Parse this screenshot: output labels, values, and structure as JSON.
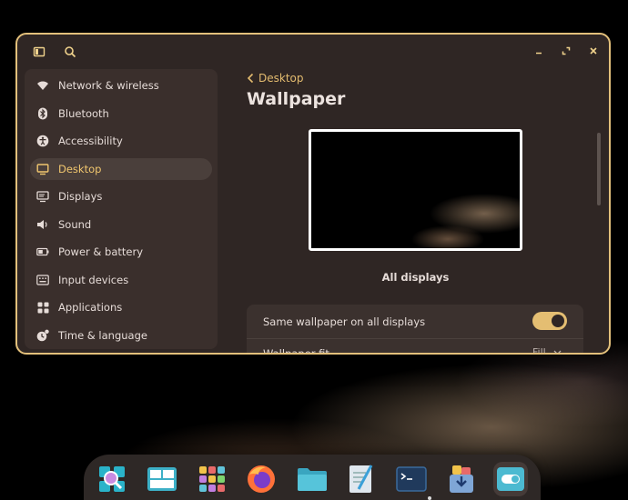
{
  "sidebar": {
    "items": [
      {
        "label": "Network & wireless",
        "icon": "wifi-icon"
      },
      {
        "label": "Bluetooth",
        "icon": "bluetooth-icon"
      },
      {
        "label": "Accessibility",
        "icon": "accessibility-icon"
      },
      {
        "label": "Desktop",
        "icon": "desktop-icon",
        "active": true
      },
      {
        "label": "Displays",
        "icon": "displays-icon"
      },
      {
        "label": "Sound",
        "icon": "speaker-icon"
      },
      {
        "label": "Power & battery",
        "icon": "battery-icon"
      },
      {
        "label": "Input devices",
        "icon": "keyboard-icon"
      },
      {
        "label": "Applications",
        "icon": "applications-grid-icon"
      },
      {
        "label": "Time & language",
        "icon": "clock-icon"
      }
    ]
  },
  "content": {
    "back_label": "Desktop",
    "title": "Wallpaper",
    "preview_caption": "All displays",
    "rows": {
      "same_wallpaper_label": "Same wallpaper on all displays",
      "same_wallpaper_enabled": true,
      "fit_label": "Wallpaper fit",
      "fit_value": "Fill"
    }
  },
  "dock": {
    "apps": [
      "launcher-icon",
      "workspaces-icon",
      "app-library-icon",
      "firefox-icon",
      "files-icon",
      "text-editor-icon",
      "terminal-icon",
      "store-icon",
      "settings-icon"
    ],
    "active_app": "settings-icon"
  },
  "colors": {
    "accent": "#e4be72",
    "window_bg": "#2f2624",
    "sidebar_bg": "#3a2f2c"
  }
}
